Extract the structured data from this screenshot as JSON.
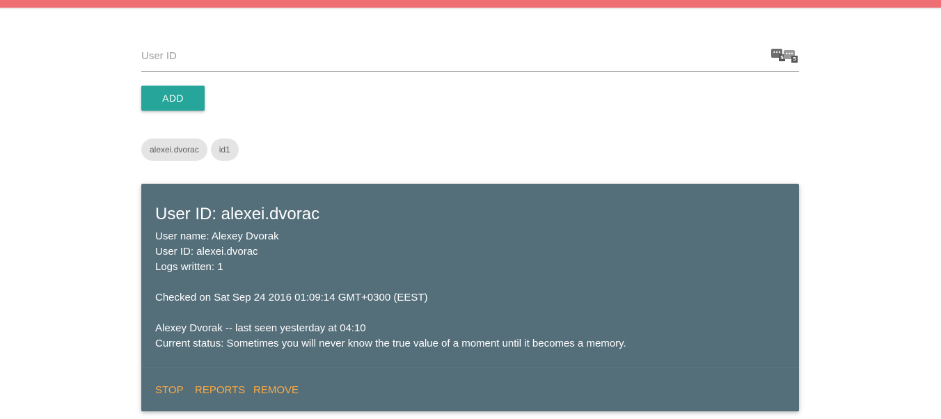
{
  "colors": {
    "topbar": "#ee6e73",
    "accent": "#26a69a",
    "card_bg": "#546e7a",
    "card_action": "#ffab40",
    "chip_bg": "#e4e4e4"
  },
  "form": {
    "user_id_placeholder": "User ID",
    "user_id_value": "",
    "password_manager_icons": [
      "password-manager-icon",
      "password-manager-icon"
    ],
    "password_manager_badge_a": "5",
    "password_manager_badge_b": "5",
    "add_label": "ADD"
  },
  "chips": [
    "alexei.dvorac",
    "id1"
  ],
  "card": {
    "title": "User ID: alexei.dvorac",
    "user_name": "User name: Alexey Dvorak",
    "user_id": "User ID: alexei.dvorac",
    "logs_written": "Logs written: 1",
    "checked_on": "Checked on Sat Sep 24 2016 01:09:14 GMT+0300 (EEST)",
    "last_seen": "Alexey Dvorak -- last seen yesterday at 04:10",
    "current_status": "Current status: Sometimes you will never know the true value of a moment until it becomes a memory.",
    "actions": {
      "stop": "STOP",
      "reports": "REPORTS",
      "remove": "REMOVE"
    }
  }
}
